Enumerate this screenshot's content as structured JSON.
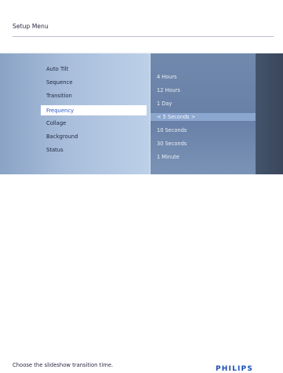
{
  "screen": {
    "title": "Setup Menu",
    "hint": "Choose the slideshow transition time.",
    "brand": "PHILIPS"
  },
  "menu": {
    "items": [
      {
        "label": "Auto Tilt",
        "selected": false
      },
      {
        "label": "Sequence",
        "selected": false
      },
      {
        "label": "Transition",
        "selected": false
      },
      {
        "label": "Frequency",
        "selected": true
      },
      {
        "label": "Collage",
        "selected": false
      },
      {
        "label": "Background",
        "selected": false
      },
      {
        "label": "Status",
        "selected": false
      }
    ]
  },
  "options": {
    "items": [
      {
        "label": "4 Hours",
        "selected": false
      },
      {
        "label": "12 Hours",
        "selected": false
      },
      {
        "label": "1 Day",
        "selected": false
      },
      {
        "label": "< 5 Seconds >",
        "selected": true
      },
      {
        "label": "10 Seconds",
        "selected": false
      },
      {
        "label": "30 Seconds",
        "selected": false
      },
      {
        "label": "1 Minute",
        "selected": false
      }
    ]
  },
  "colors": {
    "accent": "#2a58c8",
    "brand": "#1b4fb8",
    "left_panel": "#a9bedb",
    "middle_panel": "#6880a6",
    "right_panel": "#3a465b",
    "selected_option_bg": "#8ba6cf"
  }
}
